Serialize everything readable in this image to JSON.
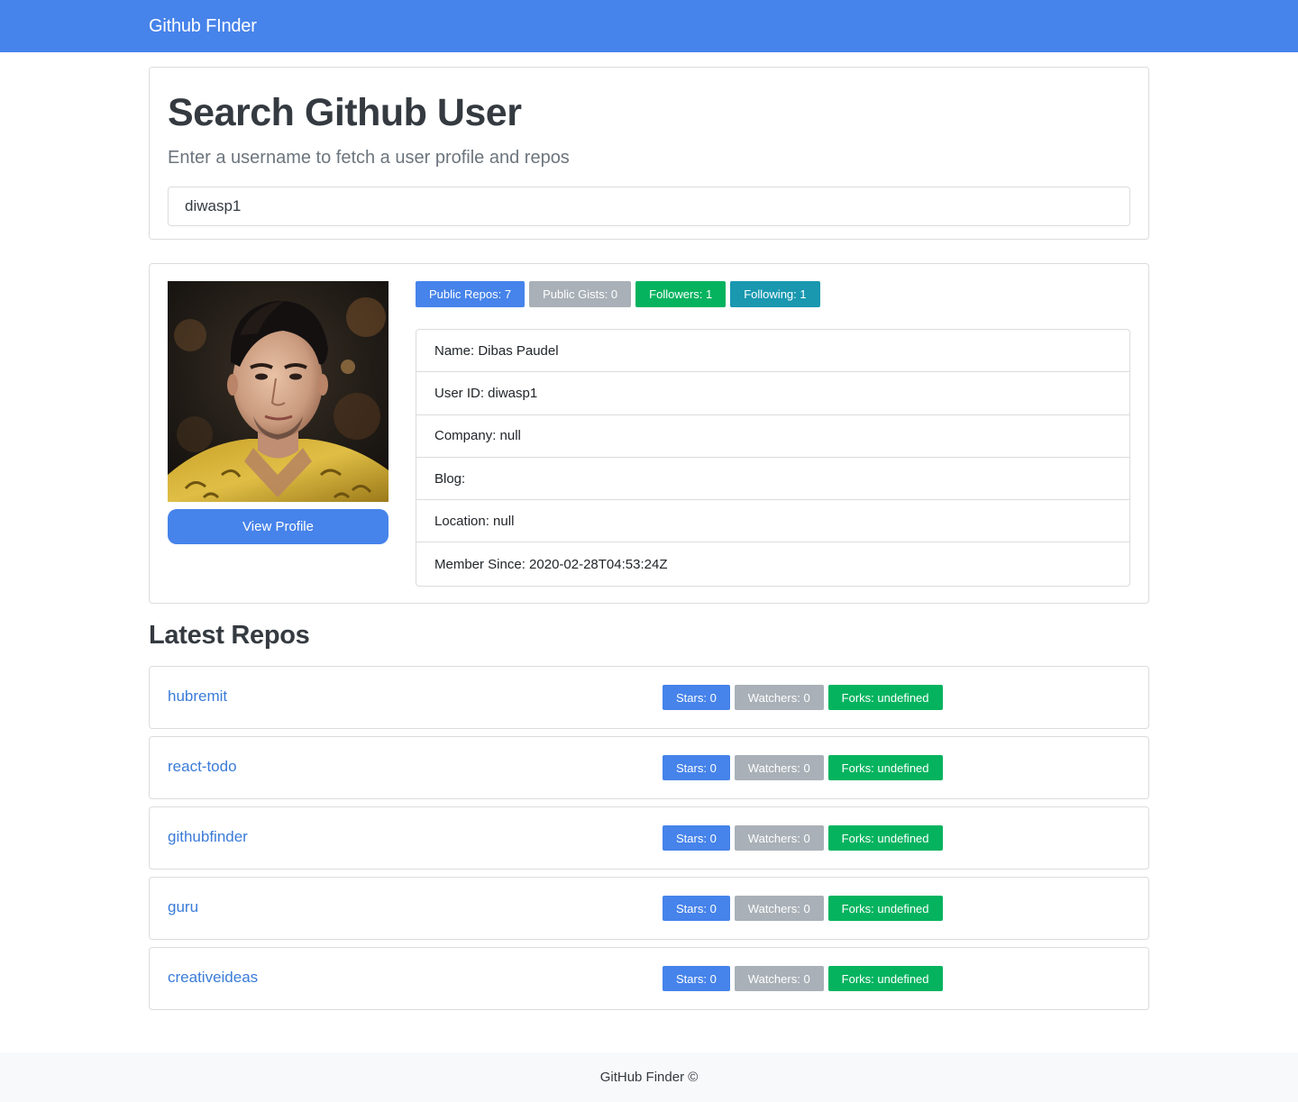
{
  "navbar": {
    "brand": "Github FInder"
  },
  "search": {
    "title": "Search Github User",
    "subtitle": "Enter a username to fetch a user profile and repos",
    "input_value": "diwasp1"
  },
  "profile": {
    "avatar_icon": "user-avatar-photo",
    "view_profile_label": "View Profile",
    "badges": [
      {
        "label": "Public Repos: 7",
        "color": "#4683ea"
      },
      {
        "label": "Public Gists: 0",
        "color": "#a9b0b7"
      },
      {
        "label": "Followers: 1",
        "color": "#05b35f"
      },
      {
        "label": "Following: 1",
        "color": "#1998b0"
      }
    ],
    "details": [
      "Name: Dibas Paudel",
      "User ID: diwasp1",
      "Company: null",
      "Blog:",
      "Location: null",
      "Member Since: 2020-02-28T04:53:24Z"
    ]
  },
  "repos": {
    "title": "Latest Repos",
    "items": [
      {
        "name": "hubremit",
        "stars": "Stars: 0",
        "watchers": "Watchers: 0",
        "forks": "Forks: undefined"
      },
      {
        "name": "react-todo",
        "stars": "Stars: 0",
        "watchers": "Watchers: 0",
        "forks": "Forks: undefined"
      },
      {
        "name": "githubfinder",
        "stars": "Stars: 0",
        "watchers": "Watchers: 0",
        "forks": "Forks: undefined"
      },
      {
        "name": "guru",
        "stars": "Stars: 0",
        "watchers": "Watchers: 0",
        "forks": "Forks: undefined"
      },
      {
        "name": "creativeideas",
        "stars": "Stars: 0",
        "watchers": "Watchers: 0",
        "forks": "Forks: undefined"
      }
    ]
  },
  "footer": {
    "text": "GitHub Finder ©"
  },
  "colors": {
    "primary": "#4683ea",
    "secondary": "#a9b0b7",
    "success": "#05b35f",
    "info": "#1998b0",
    "link": "#3a7bd8"
  }
}
